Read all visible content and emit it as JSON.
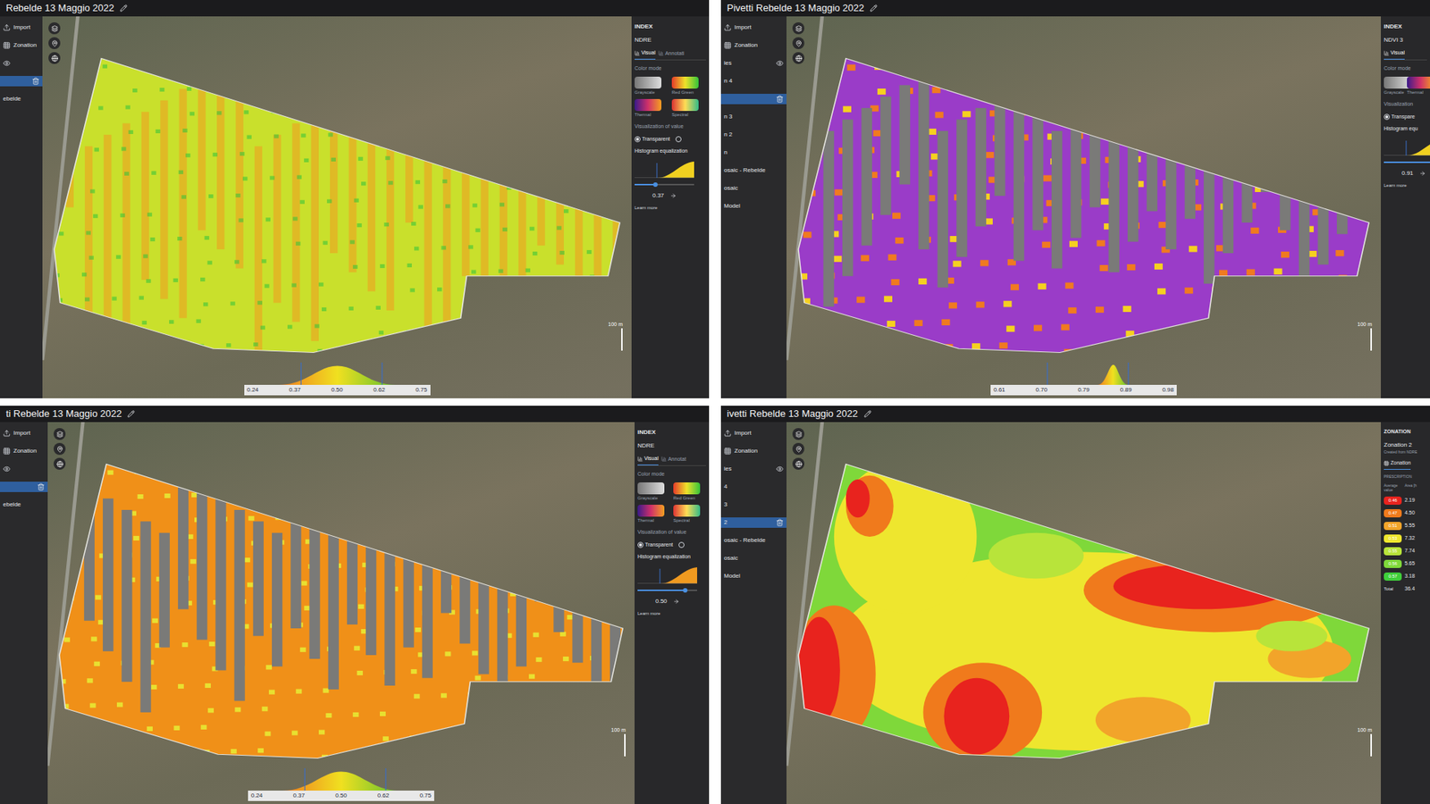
{
  "panels": [
    {
      "title": "Rebelde 13 Maggio 2022",
      "overlay": "ndre-full",
      "sidebar": [
        {
          "label": "Import",
          "kind": "import",
          "selected": false
        },
        {
          "label": "Zonation",
          "kind": "zonation",
          "selected": false
        },
        {
          "kind": "eye",
          "selected": false
        },
        {
          "kind": "layer",
          "selected": true
        },
        {
          "label": "ebelde",
          "kind": "text",
          "selected": false
        }
      ],
      "right": {
        "kind": "index",
        "heading": "INDEX",
        "index": "NDRE",
        "tabs": [
          {
            "label": "Visual",
            "selected": true
          },
          {
            "label": "Annotati",
            "selected": false
          }
        ],
        "color_mode": "Color mode",
        "swatches": [
          {
            "label": "Grayscale",
            "kind": "grayscale"
          },
          {
            "label": "Red Green",
            "kind": "redgreen"
          },
          {
            "label": "Thermal",
            "kind": "thermal"
          },
          {
            "label": "Spectral",
            "kind": "spectral"
          }
        ],
        "values_label": "Visualization of value",
        "radios": [
          {
            "label": "Transparent",
            "selected": true
          },
          {
            "selected": false
          }
        ],
        "hist_label": "Histogram equalization",
        "slider": {
          "level": 0.35,
          "value": "0.37"
        },
        "link": "Learn more"
      },
      "legend": {
        "ticks": [
          "0.24",
          "0.37",
          "0.50",
          "0.62",
          "0.75"
        ]
      },
      "scale": "100 m"
    },
    {
      "title": "Pivetti  Rebelde 13 Maggio 2022",
      "overlay": "ndvi-transparent",
      "sidebar": [
        {
          "label": "Import",
          "kind": "import",
          "selected": false
        },
        {
          "label": "Zonation",
          "kind": "zonation",
          "selected": false
        },
        {
          "label": "ies",
          "kind": "eye",
          "selected": false
        },
        {
          "label": "n 4",
          "kind": "text",
          "selected": false
        },
        {
          "kind": "layer",
          "selected": true
        },
        {
          "label": "n 3",
          "kind": "text",
          "selected": false
        },
        {
          "label": "n 2",
          "kind": "text",
          "selected": false
        },
        {
          "label": "n",
          "kind": "text",
          "selected": false
        },
        {
          "label": "osaic - Rebelde",
          "kind": "text",
          "selected": false
        },
        {
          "label": "osaic",
          "kind": "text",
          "selected": false
        },
        {
          "label": "Model",
          "kind": "text",
          "selected": false
        }
      ],
      "right": {
        "kind": "index",
        "heading": "INDEX",
        "index": "NDVI 3",
        "tabs": [
          {
            "label": "Visual",
            "selected": true
          }
        ],
        "color_mode": "Color mode",
        "swatches": [
          {
            "label": "Grayscale",
            "kind": "grayscale"
          },
          {
            "label": "Thermal",
            "kind": "thermal"
          }
        ],
        "values_label": "Visualization",
        "radios": [
          {
            "label": "Transpare",
            "selected": true
          }
        ],
        "hist_label": "Histogram equ",
        "slider": {
          "level": 0.9,
          "value": "0.91"
        },
        "link": "Learn more"
      },
      "legend": {
        "ticks": [
          "0.61",
          "0.70",
          "0.79",
          "0.89",
          "0.98"
        ]
      },
      "scale": "100 m"
    },
    {
      "title": "ti  Rebelde 13 Maggio 2022",
      "overlay": "ndre-transparent",
      "sidebar": [
        {
          "label": "Import",
          "kind": "import",
          "selected": false
        },
        {
          "label": "Zonation",
          "kind": "zonation",
          "selected": false
        },
        {
          "kind": "eye",
          "selected": false
        },
        {
          "kind": "layer",
          "selected": true
        },
        {
          "label": "ebelde",
          "kind": "text",
          "selected": false
        }
      ],
      "right": {
        "kind": "index",
        "heading": "INDEX",
        "index": "NDRE",
        "tabs": [
          {
            "label": "Visual",
            "selected": true
          },
          {
            "label": "Annotat",
            "selected": false
          }
        ],
        "color_mode": "Color mode",
        "swatches": [
          {
            "label": "Grayscale",
            "kind": "grayscale"
          },
          {
            "label": "Red Green",
            "kind": "redgreen"
          },
          {
            "label": "Thermal",
            "kind": "thermal"
          },
          {
            "label": "Spectral",
            "kind": "spectral"
          }
        ],
        "values_label": "Visualization of value",
        "radios": [
          {
            "label": "Transparent",
            "selected": true
          },
          {
            "selected": false
          }
        ],
        "hist_label": "Histogram equalization",
        "slider": {
          "level": 0.8,
          "value": "0.50"
        },
        "link": "Learn more"
      },
      "legend": {
        "ticks": [
          "0.24",
          "0.37",
          "0.50",
          "0.62",
          "0.75"
        ]
      },
      "scale": "100 m"
    },
    {
      "title": "ivetti  Rebelde 13 Maggio 2022",
      "overlay": "zones",
      "sidebar": [
        {
          "label": "Import",
          "kind": "import",
          "selected": false
        },
        {
          "label": "Zonation",
          "kind": "zonation",
          "selected": false
        },
        {
          "label": "ies",
          "kind": "eye",
          "selected": false
        },
        {
          "label": "4",
          "kind": "text",
          "selected": false
        },
        {
          "label": "3",
          "kind": "text",
          "selected": false
        },
        {
          "label": "2",
          "kind": "layer",
          "selected": true
        },
        {
          "label": "osaic - Rebelde",
          "kind": "text",
          "selected": false
        },
        {
          "label": "osaic",
          "kind": "text",
          "selected": false
        },
        {
          "label": "Model",
          "kind": "text",
          "selected": false
        }
      ],
      "right": {
        "kind": "zonation",
        "heading": "ZONATION",
        "name": "Zonation 2",
        "sub": "Created from NDRE",
        "button": "Zonation",
        "section": "PRESCRIPTION",
        "columns": [
          "Average value",
          "Area [h"
        ],
        "rows": [
          {
            "value": "0.46",
            "area": "2.19",
            "color": "#e8231e"
          },
          {
            "value": "0.47",
            "area": "4.50",
            "color": "#f07a1c"
          },
          {
            "value": "0.51",
            "area": "5.55",
            "color": "#f2a42a"
          },
          {
            "value": "0.53",
            "area": "7.32",
            "color": "#eee62e"
          },
          {
            "value": "0.55",
            "area": "7.74",
            "color": "#b8e43a"
          },
          {
            "value": "0.56",
            "area": "5.65",
            "color": "#7fd83a"
          },
          {
            "value": "0.57",
            "area": "3.18",
            "color": "#3fcf3a"
          }
        ],
        "total": {
          "label": "Total",
          "value": "36.4"
        }
      },
      "scale": "100 m"
    }
  ]
}
